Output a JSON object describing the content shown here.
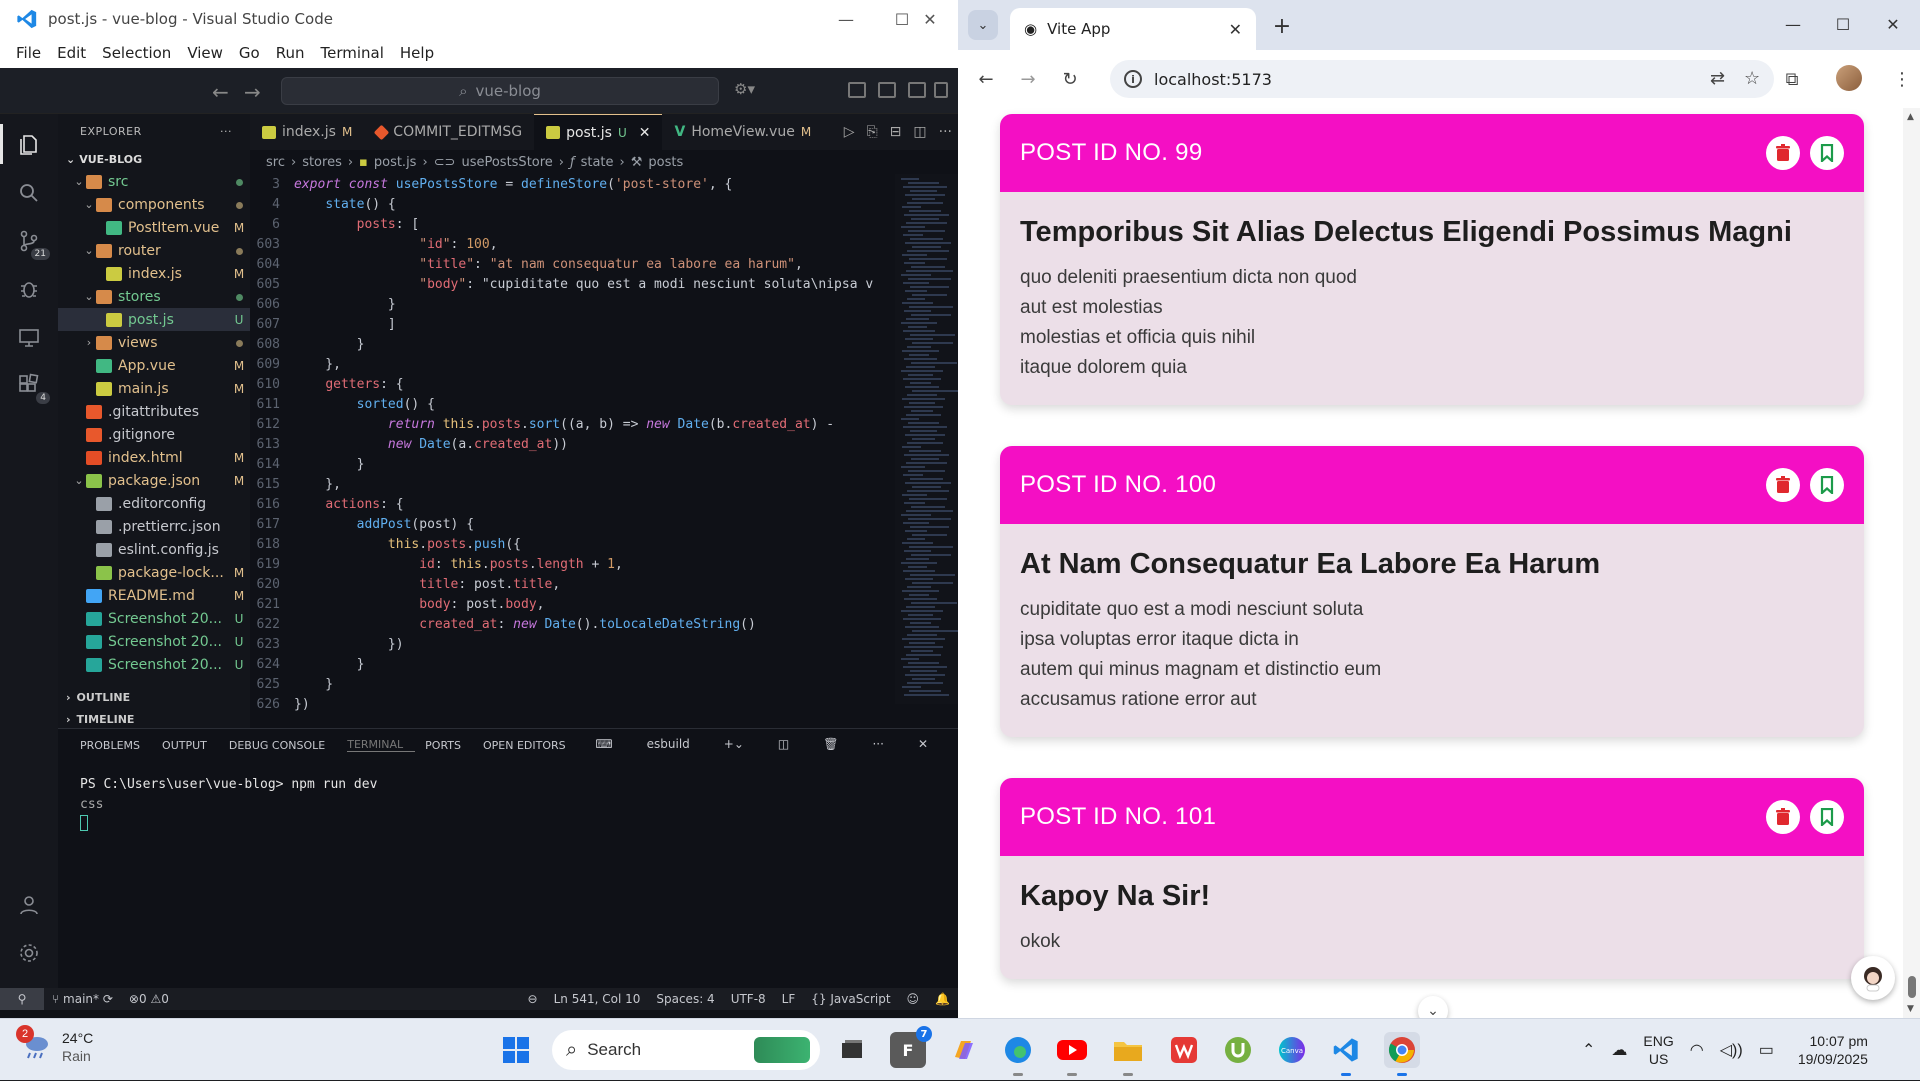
{
  "vscode": {
    "title": "post.js - vue-blog - Visual Studio Code",
    "menu": [
      "File",
      "Edit",
      "Selection",
      "View",
      "Go",
      "Run",
      "Terminal",
      "Help"
    ],
    "search_text": "vue-blog",
    "badges": {
      "source_control": "21",
      "extensions": "4"
    },
    "explorer": {
      "heading": "EXPLORER",
      "root": "VUE-BLOG",
      "items": [
        {
          "label": "src",
          "status": ""
        },
        {
          "label": "components",
          "status": ""
        },
        {
          "label": "PostItem.vue",
          "status": "M"
        },
        {
          "label": "router",
          "status": ""
        },
        {
          "label": "index.js",
          "status": "M"
        },
        {
          "label": "stores",
          "status": ""
        },
        {
          "label": "post.js",
          "status": "U"
        },
        {
          "label": "views",
          "status": ""
        },
        {
          "label": "App.vue",
          "status": "M"
        },
        {
          "label": "main.js",
          "status": "M"
        },
        {
          "label": ".gitattributes",
          "status": ""
        },
        {
          "label": ".gitignore",
          "status": ""
        },
        {
          "label": "index.html",
          "status": "M"
        },
        {
          "label": "package.json",
          "status": "M"
        },
        {
          "label": ".editorconfig",
          "status": ""
        },
        {
          "label": ".prettierrc.json",
          "status": ""
        },
        {
          "label": "eslint.config.js",
          "status": ""
        },
        {
          "label": "package-lock...",
          "status": "M"
        },
        {
          "label": "README.md",
          "status": "M"
        },
        {
          "label": "Screenshot 20...",
          "status": "U"
        },
        {
          "label": "Screenshot 20...",
          "status": "U"
        },
        {
          "label": "Screenshot 20...",
          "status": "U"
        }
      ],
      "outline": "OUTLINE",
      "timeline": "TIMELINE"
    },
    "tabs": [
      {
        "label": "index.js",
        "status": "M"
      },
      {
        "label": "COMMIT_EDITMSG",
        "status": ""
      },
      {
        "label": "post.js",
        "status": "U"
      },
      {
        "label": "HomeView.vue",
        "status": "M"
      }
    ],
    "breadcrumb": [
      "src",
      "stores",
      "post.js",
      "usePostsStore",
      "state",
      "posts"
    ],
    "code_lines": [
      {
        "n": "3",
        "t": "export const usePostsStore = defineStore('post-store', {"
      },
      {
        "n": "4",
        "t": "    state() {"
      },
      {
        "n": "6",
        "t": "        posts: ["
      },
      {
        "n": "603",
        "t": "                \"id\": 100,"
      },
      {
        "n": "604",
        "t": "                \"title\": \"at nam consequatur ea labore ea harum\","
      },
      {
        "n": "605",
        "t": "                \"body\": \"cupiditate quo est a modi nesciunt soluta\\nipsa v"
      },
      {
        "n": "606",
        "t": "            }"
      },
      {
        "n": "607",
        "t": "            ]"
      },
      {
        "n": "608",
        "t": "        }"
      },
      {
        "n": "609",
        "t": "    },"
      },
      {
        "n": "610",
        "t": "    getters: {"
      },
      {
        "n": "611",
        "t": "        sorted() {"
      },
      {
        "n": "612",
        "t": "            return this.posts.sort((a, b) => new Date(b.created_at) -"
      },
      {
        "n": "613",
        "t": "            new Date(a.created_at))"
      },
      {
        "n": "614",
        "t": "        }"
      },
      {
        "n": "615",
        "t": "    },"
      },
      {
        "n": "616",
        "t": "    actions: {"
      },
      {
        "n": "617",
        "t": "        addPost(post) {"
      },
      {
        "n": "618",
        "t": "            this.posts.push({"
      },
      {
        "n": "619",
        "t": "                id: this.posts.length + 1,"
      },
      {
        "n": "620",
        "t": "                title: post.title,"
      },
      {
        "n": "621",
        "t": "                body: post.body,"
      },
      {
        "n": "622",
        "t": "                created_at: new Date().toLocaleDateString()"
      },
      {
        "n": "623",
        "t": "            })"
      },
      {
        "n": "624",
        "t": "        }"
      },
      {
        "n": "625",
        "t": "    }"
      },
      {
        "n": "626",
        "t": "})"
      }
    ],
    "panel_tabs": [
      "PROBLEMS",
      "OUTPUT",
      "DEBUG CONSOLE",
      "TERMINAL",
      "PORTS",
      "OPEN EDITORS"
    ],
    "terminal_name": "esbuild",
    "terminal_lines": [
      "PS C:\\Users\\user\\vue-blog> npm run dev",
      "css"
    ],
    "status": {
      "branch": "main*",
      "errors": "0",
      "warnings": "0",
      "position": "Ln 541, Col 10",
      "spaces": "Spaces: 4",
      "encoding": "UTF-8",
      "eol": "LF",
      "language": "JavaScript"
    }
  },
  "browser": {
    "tab_title": "Vite App",
    "url": "localhost:5173",
    "posts": [
      {
        "header": "POST ID NO. 99",
        "title": "Temporibus Sit Alias Delectus Eligendi Possimus Magni",
        "lines": [
          "quo deleniti praesentium dicta non quod",
          "aut est molestias",
          "molestias et officia quis nihil",
          "itaque dolorem quia"
        ]
      },
      {
        "header": "POST ID NO. 100",
        "title": "At Nam Consequatur Ea Labore Ea Harum",
        "lines": [
          "cupiditate quo est a modi nesciunt soluta",
          "ipsa voluptas error itaque dicta in",
          "autem qui minus magnam et distinctio eum",
          "accusamus ratione error aut"
        ]
      },
      {
        "header": "POST ID NO. 101",
        "title": "Kapoy Na Sir!",
        "lines": [
          "okok"
        ]
      }
    ],
    "accent_color": "#f40fc4"
  },
  "taskbar": {
    "weather_temp": "24°C",
    "weather_desc": "Rain",
    "weather_badge": "2",
    "search_label": "Search",
    "mail_badge": "7",
    "lang": "ENG",
    "region": "US",
    "time": "10:07 pm",
    "date": "19/09/2025"
  }
}
